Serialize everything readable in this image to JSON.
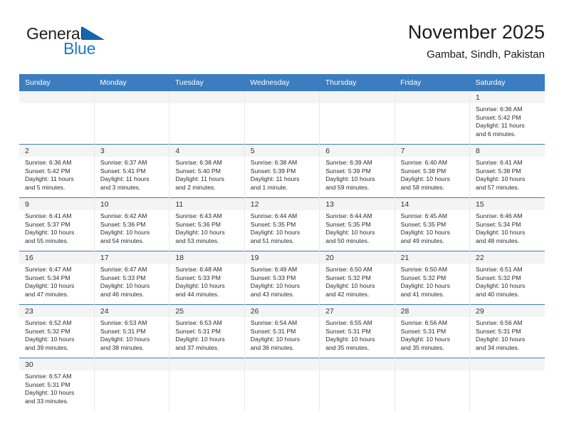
{
  "brand": {
    "name_top": "General",
    "name_bottom": "Blue",
    "flag_icon": "triangle-flag-icon",
    "color_black": "#231f20",
    "color_blue": "#1f7ac4"
  },
  "header": {
    "title": "November 2025",
    "subtitle": "Gambat, Sindh, Pakistan"
  },
  "theme": {
    "header_blue": "#3b7dbf",
    "daynum_band": "#f4f4f4",
    "text": "#2b2b2b"
  },
  "weekdays": [
    "Sunday",
    "Monday",
    "Tuesday",
    "Wednesday",
    "Thursday",
    "Friday",
    "Saturday"
  ],
  "weeks": [
    [
      {
        "day": "",
        "sunrise": "",
        "sunset": "",
        "daylight_line1": "",
        "daylight_line2": ""
      },
      {
        "day": "",
        "sunrise": "",
        "sunset": "",
        "daylight_line1": "",
        "daylight_line2": ""
      },
      {
        "day": "",
        "sunrise": "",
        "sunset": "",
        "daylight_line1": "",
        "daylight_line2": ""
      },
      {
        "day": "",
        "sunrise": "",
        "sunset": "",
        "daylight_line1": "",
        "daylight_line2": ""
      },
      {
        "day": "",
        "sunrise": "",
        "sunset": "",
        "daylight_line1": "",
        "daylight_line2": ""
      },
      {
        "day": "",
        "sunrise": "",
        "sunset": "",
        "daylight_line1": "",
        "daylight_line2": ""
      },
      {
        "day": "1",
        "sunrise": "Sunrise: 6:36 AM",
        "sunset": "Sunset: 5:42 PM",
        "daylight_line1": "Daylight: 11 hours",
        "daylight_line2": "and 6 minutes."
      }
    ],
    [
      {
        "day": "2",
        "sunrise": "Sunrise: 6:36 AM",
        "sunset": "Sunset: 5:42 PM",
        "daylight_line1": "Daylight: 11 hours",
        "daylight_line2": "and 5 minutes."
      },
      {
        "day": "3",
        "sunrise": "Sunrise: 6:37 AM",
        "sunset": "Sunset: 5:41 PM",
        "daylight_line1": "Daylight: 11 hours",
        "daylight_line2": "and 3 minutes."
      },
      {
        "day": "4",
        "sunrise": "Sunrise: 6:38 AM",
        "sunset": "Sunset: 5:40 PM",
        "daylight_line1": "Daylight: 11 hours",
        "daylight_line2": "and 2 minutes."
      },
      {
        "day": "5",
        "sunrise": "Sunrise: 6:38 AM",
        "sunset": "Sunset: 5:39 PM",
        "daylight_line1": "Daylight: 11 hours",
        "daylight_line2": "and 1 minute."
      },
      {
        "day": "6",
        "sunrise": "Sunrise: 6:39 AM",
        "sunset": "Sunset: 5:39 PM",
        "daylight_line1": "Daylight: 10 hours",
        "daylight_line2": "and 59 minutes."
      },
      {
        "day": "7",
        "sunrise": "Sunrise: 6:40 AM",
        "sunset": "Sunset: 5:38 PM",
        "daylight_line1": "Daylight: 10 hours",
        "daylight_line2": "and 58 minutes."
      },
      {
        "day": "8",
        "sunrise": "Sunrise: 6:41 AM",
        "sunset": "Sunset: 5:38 PM",
        "daylight_line1": "Daylight: 10 hours",
        "daylight_line2": "and 57 minutes."
      }
    ],
    [
      {
        "day": "9",
        "sunrise": "Sunrise: 6:41 AM",
        "sunset": "Sunset: 5:37 PM",
        "daylight_line1": "Daylight: 10 hours",
        "daylight_line2": "and 55 minutes."
      },
      {
        "day": "10",
        "sunrise": "Sunrise: 6:42 AM",
        "sunset": "Sunset: 5:36 PM",
        "daylight_line1": "Daylight: 10 hours",
        "daylight_line2": "and 54 minutes."
      },
      {
        "day": "11",
        "sunrise": "Sunrise: 6:43 AM",
        "sunset": "Sunset: 5:36 PM",
        "daylight_line1": "Daylight: 10 hours",
        "daylight_line2": "and 53 minutes."
      },
      {
        "day": "12",
        "sunrise": "Sunrise: 6:44 AM",
        "sunset": "Sunset: 5:35 PM",
        "daylight_line1": "Daylight: 10 hours",
        "daylight_line2": "and 51 minutes."
      },
      {
        "day": "13",
        "sunrise": "Sunrise: 6:44 AM",
        "sunset": "Sunset: 5:35 PM",
        "daylight_line1": "Daylight: 10 hours",
        "daylight_line2": "and 50 minutes."
      },
      {
        "day": "14",
        "sunrise": "Sunrise: 6:45 AM",
        "sunset": "Sunset: 5:35 PM",
        "daylight_line1": "Daylight: 10 hours",
        "daylight_line2": "and 49 minutes."
      },
      {
        "day": "15",
        "sunrise": "Sunrise: 6:46 AM",
        "sunset": "Sunset: 5:34 PM",
        "daylight_line1": "Daylight: 10 hours",
        "daylight_line2": "and 48 minutes."
      }
    ],
    [
      {
        "day": "16",
        "sunrise": "Sunrise: 6:47 AM",
        "sunset": "Sunset: 5:34 PM",
        "daylight_line1": "Daylight: 10 hours",
        "daylight_line2": "and 47 minutes."
      },
      {
        "day": "17",
        "sunrise": "Sunrise: 6:47 AM",
        "sunset": "Sunset: 5:33 PM",
        "daylight_line1": "Daylight: 10 hours",
        "daylight_line2": "and 46 minutes."
      },
      {
        "day": "18",
        "sunrise": "Sunrise: 6:48 AM",
        "sunset": "Sunset: 5:33 PM",
        "daylight_line1": "Daylight: 10 hours",
        "daylight_line2": "and 44 minutes."
      },
      {
        "day": "19",
        "sunrise": "Sunrise: 6:49 AM",
        "sunset": "Sunset: 5:33 PM",
        "daylight_line1": "Daylight: 10 hours",
        "daylight_line2": "and 43 minutes."
      },
      {
        "day": "20",
        "sunrise": "Sunrise: 6:50 AM",
        "sunset": "Sunset: 5:32 PM",
        "daylight_line1": "Daylight: 10 hours",
        "daylight_line2": "and 42 minutes."
      },
      {
        "day": "21",
        "sunrise": "Sunrise: 6:50 AM",
        "sunset": "Sunset: 5:32 PM",
        "daylight_line1": "Daylight: 10 hours",
        "daylight_line2": "and 41 minutes."
      },
      {
        "day": "22",
        "sunrise": "Sunrise: 6:51 AM",
        "sunset": "Sunset: 5:32 PM",
        "daylight_line1": "Daylight: 10 hours",
        "daylight_line2": "and 40 minutes."
      }
    ],
    [
      {
        "day": "23",
        "sunrise": "Sunrise: 6:52 AM",
        "sunset": "Sunset: 5:32 PM",
        "daylight_line1": "Daylight: 10 hours",
        "daylight_line2": "and 39 minutes."
      },
      {
        "day": "24",
        "sunrise": "Sunrise: 6:53 AM",
        "sunset": "Sunset: 5:31 PM",
        "daylight_line1": "Daylight: 10 hours",
        "daylight_line2": "and 38 minutes."
      },
      {
        "day": "25",
        "sunrise": "Sunrise: 6:53 AM",
        "sunset": "Sunset: 5:31 PM",
        "daylight_line1": "Daylight: 10 hours",
        "daylight_line2": "and 37 minutes."
      },
      {
        "day": "26",
        "sunrise": "Sunrise: 6:54 AM",
        "sunset": "Sunset: 5:31 PM",
        "daylight_line1": "Daylight: 10 hours",
        "daylight_line2": "and 36 minutes."
      },
      {
        "day": "27",
        "sunrise": "Sunrise: 6:55 AM",
        "sunset": "Sunset: 5:31 PM",
        "daylight_line1": "Daylight: 10 hours",
        "daylight_line2": "and 35 minutes."
      },
      {
        "day": "28",
        "sunrise": "Sunrise: 6:56 AM",
        "sunset": "Sunset: 5:31 PM",
        "daylight_line1": "Daylight: 10 hours",
        "daylight_line2": "and 35 minutes."
      },
      {
        "day": "29",
        "sunrise": "Sunrise: 6:56 AM",
        "sunset": "Sunset: 5:31 PM",
        "daylight_line1": "Daylight: 10 hours",
        "daylight_line2": "and 34 minutes."
      }
    ],
    [
      {
        "day": "30",
        "sunrise": "Sunrise: 6:57 AM",
        "sunset": "Sunset: 5:31 PM",
        "daylight_line1": "Daylight: 10 hours",
        "daylight_line2": "and 33 minutes."
      },
      {
        "day": "",
        "sunrise": "",
        "sunset": "",
        "daylight_line1": "",
        "daylight_line2": ""
      },
      {
        "day": "",
        "sunrise": "",
        "sunset": "",
        "daylight_line1": "",
        "daylight_line2": ""
      },
      {
        "day": "",
        "sunrise": "",
        "sunset": "",
        "daylight_line1": "",
        "daylight_line2": ""
      },
      {
        "day": "",
        "sunrise": "",
        "sunset": "",
        "daylight_line1": "",
        "daylight_line2": ""
      },
      {
        "day": "",
        "sunrise": "",
        "sunset": "",
        "daylight_line1": "",
        "daylight_line2": ""
      },
      {
        "day": "",
        "sunrise": "",
        "sunset": "",
        "daylight_line1": "",
        "daylight_line2": ""
      }
    ]
  ]
}
